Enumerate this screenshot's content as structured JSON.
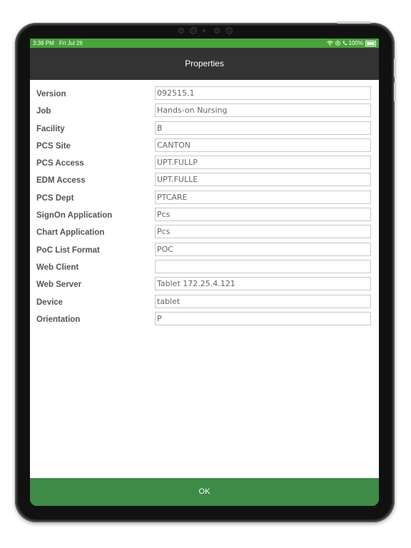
{
  "status_bar": {
    "time": "3:36 PM",
    "date": "Fri Jul 26",
    "battery": "100%",
    "icons": [
      "wifi-icon",
      "location-icon",
      "phone-icon",
      "battery-icon"
    ]
  },
  "nav": {
    "title": "Properties"
  },
  "properties": [
    {
      "label": "Version",
      "value": "092515.1"
    },
    {
      "label": "Job",
      "value": "Hands-on Nursing"
    },
    {
      "label": "Facility",
      "value": "B"
    },
    {
      "label": "PCS Site",
      "value": "CANTON"
    },
    {
      "label": "PCS Access",
      "value": "UPT.FULLP"
    },
    {
      "label": "EDM Access",
      "value": "UPT.FULLE"
    },
    {
      "label": "PCS Dept",
      "value": "PTCARE"
    },
    {
      "label": "SignOn Application",
      "value": "Pcs"
    },
    {
      "label": "Chart Application",
      "value": "Pcs"
    },
    {
      "label": "PoC List Format",
      "value": "POC"
    },
    {
      "label": "Web Client",
      "value": ""
    },
    {
      "label": "Web Server",
      "value": "Tablet 172.25.4.121"
    },
    {
      "label": "Device",
      "value": "tablet"
    },
    {
      "label": "Orientation",
      "value": "P"
    }
  ],
  "footer": {
    "ok_label": "OK"
  },
  "colors": {
    "status_green": "#4aa33a",
    "nav_dark": "#333333",
    "ok_green": "#3e8b47",
    "label_gray": "#555555"
  }
}
